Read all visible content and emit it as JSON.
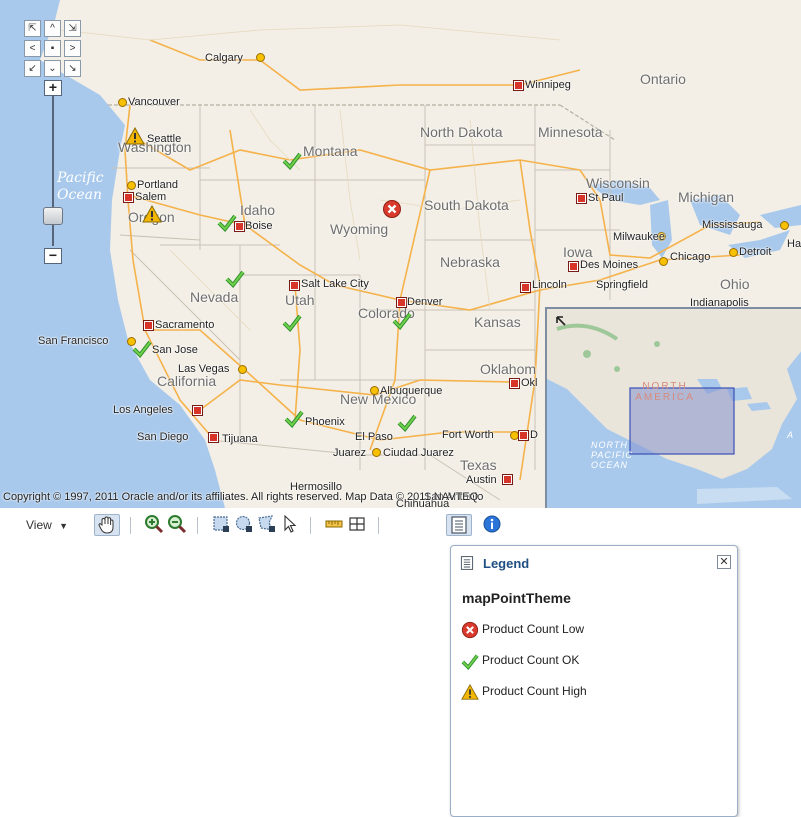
{
  "map": {
    "regions": {
      "north_dakota": "North Dakota",
      "minnesota": "Minnesota",
      "montana": "Montana",
      "washington": "Washington",
      "oregon": "Oregon",
      "idaho": "Idaho",
      "wyoming": "Wyoming",
      "south_dakota": "South Dakota",
      "wisconsin": "Wisconsin",
      "michigan": "Michigan",
      "iowa": "Iowa",
      "nebraska": "Nebraska",
      "nevada": "Nevada",
      "utah": "Utah",
      "colorado": "Colorado",
      "kansas": "Kansas",
      "california": "California",
      "oklahoma": "Oklahom",
      "new_mexico": "New Mexico",
      "texas": "Texas",
      "ontario": "Ontario",
      "ohio": "Ohio"
    },
    "ocean": {
      "line1": "Pacific",
      "line2": "Ocean"
    },
    "cities": {
      "calgary": "Calgary",
      "winnipeg": "Winnipeg",
      "vancouver": "Vancouver",
      "seattle": "Seattle",
      "portland": "Portland",
      "salem": "Salem",
      "boise": "Boise",
      "st_paul": "St Paul",
      "milwaukee": "Milwaukee",
      "mississauga": "Mississauga",
      "detroit": "Detroit",
      "ha": "Ha",
      "des_moines": "Des Moines",
      "chicago": "Chicago",
      "lincoln": "Lincoln",
      "springfield": "Springfield",
      "indianapolis": "Indianapolis",
      "salt_lake_city": "Salt Lake City",
      "denver": "Denver",
      "sacramento": "Sacramento",
      "san_francisco": "San Francisco",
      "san_jose": "San Jose",
      "las_vegas": "Las Vegas",
      "los_angeles": "Los Angeles",
      "san_diego": "San Diego",
      "tijuana": "Tijuana",
      "phoenix": "Phoenix",
      "albuquerque": "Albuquerque",
      "el_paso": "El Paso",
      "juarez": "Juarez",
      "ciudad_juarez": "Ciudad Juarez",
      "fort_worth": "Fort Worth",
      "d": "D",
      "okl": "Okl",
      "austin": "Austin",
      "hermosillo": "Hermosillo",
      "chihuahua": "Chihuahua",
      "san_antonio": "San Antonio"
    },
    "copyright": "Copyright © 1997, 2011 Oracle and/or its affiliates. All rights reserved. Map Data © 2011 NAVTEQ.",
    "overview": {
      "north_america": "NORTH AMERICA",
      "pacific_ocean": "NORTH PACIFIC OCEAN",
      "a": "A"
    }
  },
  "toolbar": {
    "view_label": "View"
  },
  "legend": {
    "title": "Legend",
    "theme": "mapPointTheme",
    "items": [
      {
        "label": "Product Count Low",
        "icon": "error-icon",
        "color": "#d83b2d"
      },
      {
        "label": "Product Count OK",
        "icon": "check-icon",
        "color": "#3aa83a"
      },
      {
        "label": "Product Count High",
        "icon": "warning-icon",
        "color": "#f2b705"
      }
    ]
  },
  "colors": {
    "water": "#a9c9ec",
    "land": "#f3efe6",
    "highway": "#f5b24a",
    "border": "#b6b0a4",
    "accent": "#1f4f82"
  }
}
